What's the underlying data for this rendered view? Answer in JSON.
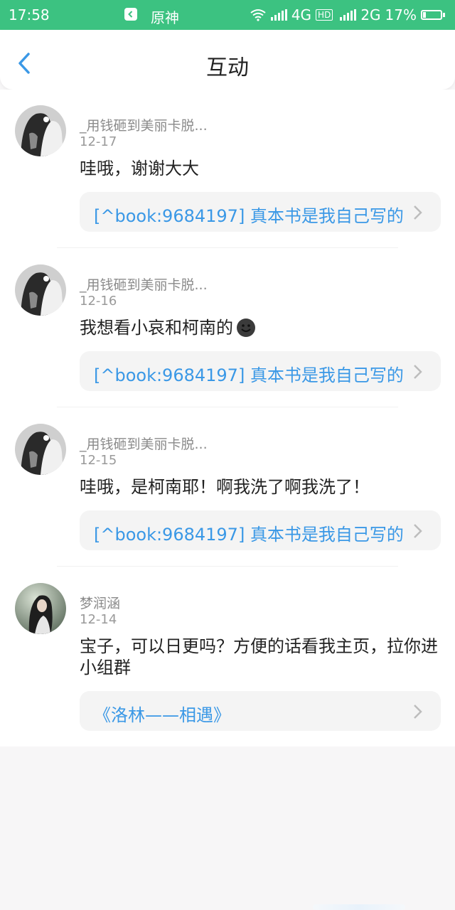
{
  "status_bar": {
    "time": "17:58",
    "app_name": "原神",
    "network_4g": "4G",
    "hd": "HD",
    "network_2g": "2G",
    "battery": "17%",
    "battery_level": 0.17
  },
  "nav": {
    "title": "互动"
  },
  "comments": [
    {
      "username": "_用钱砸到美丽卡脱...",
      "date": "12-17",
      "content": "哇哦，谢谢大大",
      "book": "[^book:9684197]  真本书是我自己写的...",
      "avatar": "avatar-anime"
    },
    {
      "username": "_用钱砸到美丽卡脱...",
      "date": "12-16",
      "content": "我想看小哀和柯南的",
      "book": "[^book:9684197]  真本书是我自己写的...",
      "avatar": "avatar-anime",
      "emoji": "smile-emoji"
    },
    {
      "username": "_用钱砸到美丽卡脱...",
      "date": "12-15",
      "content": "哇哦，是柯南耶！啊我洗了啊我洗了！",
      "book": "[^book:9684197]  真本书是我自己写的...",
      "avatar": "avatar-anime"
    },
    {
      "username": "梦润涵",
      "date": "12-14",
      "content": "宝子，可以日更吗？方便的话看我主页，拉你进小组群",
      "book": "《洛林——相遇》",
      "avatar": "avatar-photo"
    }
  ],
  "colors": {
    "status_bar": "#3cc281",
    "accent": "#3a98e6"
  }
}
